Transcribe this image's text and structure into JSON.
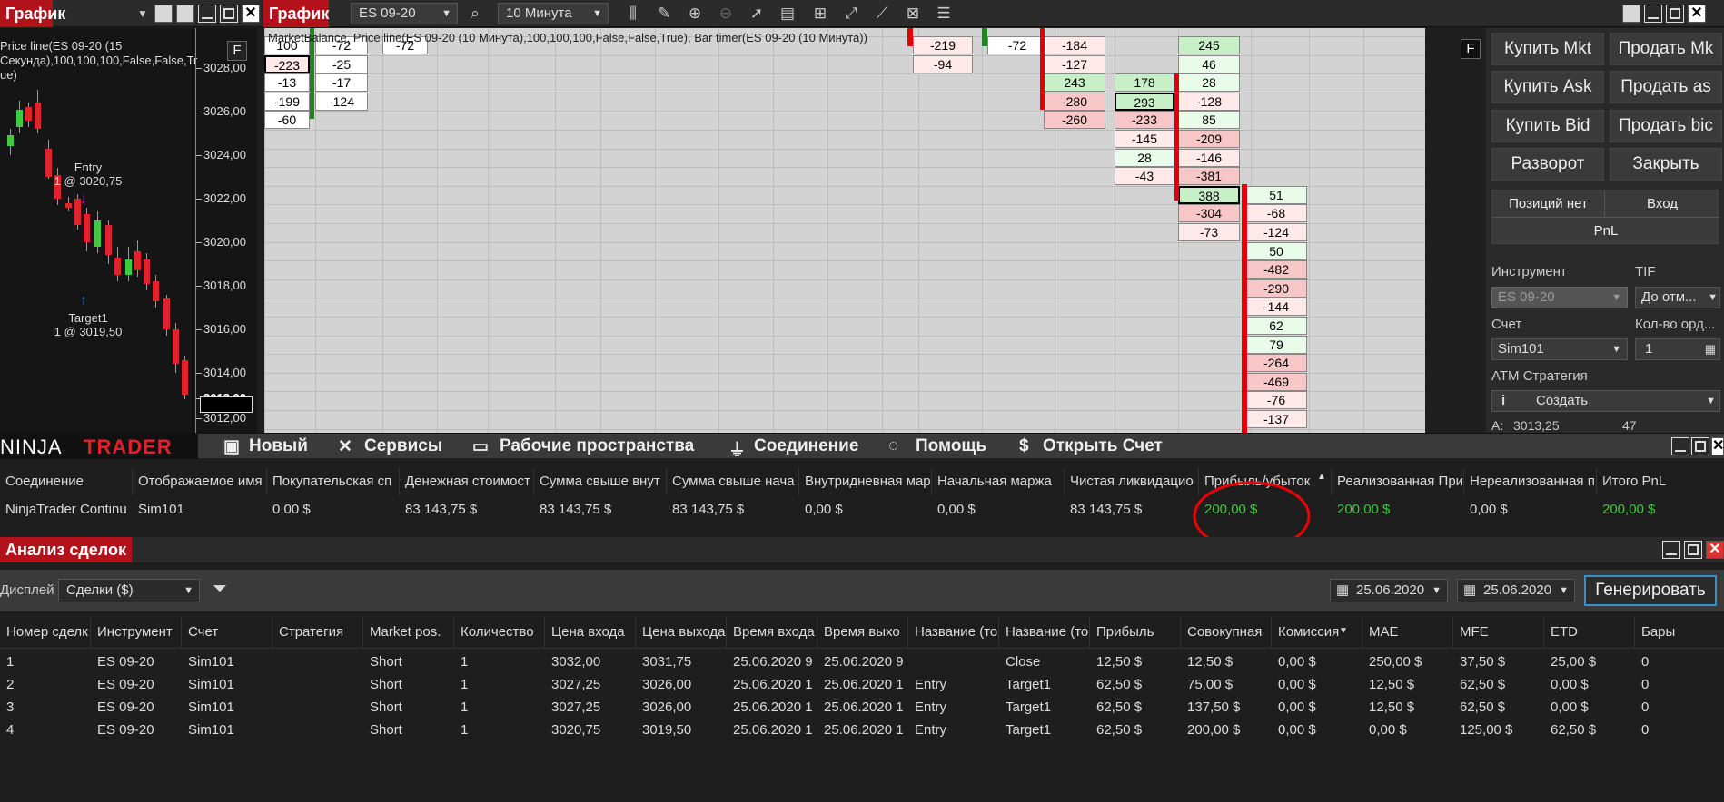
{
  "topbar": {
    "tab1": "График",
    "tab2": "График",
    "instrument": "ES 09-20",
    "interval": "10 Минута"
  },
  "chart": {
    "title": "Price line(ES 09-20 (15 Секунда),100,100,100,False,False,Tr ue)",
    "f_label": "F",
    "y_labels": [
      "3028,00",
      "3026,00",
      "3024,00",
      "3022,00",
      "3020,00",
      "3018,00",
      "3016,00",
      "3014,00",
      "3013,00",
      "3012,00"
    ],
    "entry_label": "Entry",
    "entry_value": "1 @ 3020,75",
    "target_label": "Target1",
    "target_value": "1 @ 3019,50",
    "colors": {
      "up": "#3fc93f",
      "down": "#e0222a"
    }
  },
  "ladder": {
    "header": "MarketBalance, Price line(ES 09-20 (10 Минута),100,100,100,False,False,True), Bar timer(ES 09-20 (10 Минута))",
    "f_label": "F",
    "price_labels": [
      "3028,00",
      "3026,00",
      "3024,00",
      "3022,00",
      "3020,00",
      "3018,00",
      "3016,00"
    ],
    "col1": [
      "100",
      "-223",
      "-13",
      "-199",
      "-60"
    ],
    "col2": [
      "-72",
      "-25",
      "-17",
      "-124"
    ],
    "col3": [
      "-72"
    ],
    "col4": [
      "-219",
      "-94"
    ],
    "col5": [
      "-72"
    ],
    "col6": [
      "-184",
      "-127",
      "243",
      "-280",
      "-260"
    ],
    "col7": [
      "178",
      "293",
      "-233",
      "-145",
      "28",
      "-43"
    ],
    "col8": [
      "245",
      "46",
      "28",
      "-128",
      "85",
      "-209",
      "-146",
      "-381",
      "388",
      "-304",
      "-73"
    ],
    "col9": [
      "51",
      "-68",
      "-124",
      "50",
      "-482",
      "-290",
      "-144",
      "62",
      "79",
      "-264",
      "-469",
      "-76",
      "-137"
    ]
  },
  "rpanel": {
    "buy_mkt": "Купить Mkt",
    "sell_mkt": "Продать Mk",
    "buy_ask": "Купить Ask",
    "sell_ask": "Продать as",
    "buy_bid": "Купить Bid",
    "sell_bid": "Продать bic",
    "reverse": "Разворот",
    "close": "Закрыть",
    "no_position": "Позиций нет",
    "entry": "Вход",
    "pnl": "PnL",
    "instrument_label": "Инструмент",
    "tif_label": "TIF",
    "instrument_value": "ES 09-20",
    "tif_value": "До отм...",
    "account_label": "Счет",
    "qty_label": "Кол-во орд...",
    "account_value": "Sim101",
    "qty_value": "1",
    "atm_label": "ATM Стратегия",
    "atm_value": "Создать",
    "info": "i",
    "a_label": "A:",
    "a_value": "3013,25",
    "a_qty": "47"
  },
  "menubar": {
    "logo_ninja": "NINJA",
    "logo_trader": "TRADER",
    "new": "Новый",
    "services": "Сервисы",
    "workspaces": "Рабочие пространства",
    "connection": "Соединение",
    "help": "Помощь",
    "open_account": "Открыть Счет"
  },
  "accounts": {
    "headers": [
      "Соединение",
      "Отображаемое имя",
      "Покупательская сп",
      "Денежная стоимост",
      "Сумма свыше внут",
      "Сумма свыше нача",
      "Внутридневная мар",
      "Начальная маржа",
      "Чистая ликвидацио",
      "Прибыль/убыток",
      "Реализованная При",
      "Нереализованная п",
      "Итого PnL"
    ],
    "row": [
      "NinjaTrader Continu",
      "Sim101",
      "0,00 $",
      "83 143,75 $",
      "83 143,75 $",
      "83 143,75 $",
      "0,00 $",
      "0,00 $",
      "83 143,75 $",
      "200,00 $",
      "200,00 $",
      "0,00 $",
      "200,00 $"
    ]
  },
  "trade_analysis": {
    "title": "Анализ сделок",
    "display_label": "Дисплей",
    "display_value": "Сделки ($)",
    "date_from": "25.06.2020",
    "date_to": "25.06.2020",
    "generate": "Генерировать",
    "headers": [
      "Номер сделк",
      "Инструмент",
      "Счет",
      "Стратегия",
      "Market pos.",
      "Количество",
      "Цена входа",
      "Цена выхода",
      "Время входа",
      "Время выхо",
      "Название (то",
      "Название (то",
      "Прибыль",
      "Совокупная",
      "Комиссия",
      "MAE",
      "MFE",
      "ETD",
      "Бары"
    ],
    "rows": [
      [
        "1",
        "ES 09-20",
        "Sim101",
        "",
        "Short",
        "1",
        "3032,00",
        "3031,75",
        "25.06.2020 9",
        "25.06.2020 9",
        "",
        "Close",
        "12,50 $",
        "12,50 $",
        "0,00 $",
        "250,00 $",
        "37,50 $",
        "25,00 $",
        "0"
      ],
      [
        "2",
        "ES 09-20",
        "Sim101",
        "",
        "Short",
        "1",
        "3027,25",
        "3026,00",
        "25.06.2020 1",
        "25.06.2020 1",
        "Entry",
        "Target1",
        "62,50 $",
        "75,00 $",
        "0,00 $",
        "12,50 $",
        "62,50 $",
        "0,00 $",
        "0"
      ],
      [
        "3",
        "ES 09-20",
        "Sim101",
        "",
        "Short",
        "1",
        "3027,25",
        "3026,00",
        "25.06.2020 1",
        "25.06.2020 1",
        "Entry",
        "Target1",
        "62,50 $",
        "137,50 $",
        "0,00 $",
        "12,50 $",
        "62,50 $",
        "0,00 $",
        "0"
      ],
      [
        "4",
        "ES 09-20",
        "Sim101",
        "",
        "Short",
        "1",
        "3020,75",
        "3019,50",
        "25.06.2020 1",
        "25.06.2020 1",
        "Entry",
        "Target1",
        "62,50 $",
        "200,00 $",
        "0,00 $",
        "0,00 $",
        "125,00 $",
        "62,50 $",
        "0"
      ]
    ]
  }
}
